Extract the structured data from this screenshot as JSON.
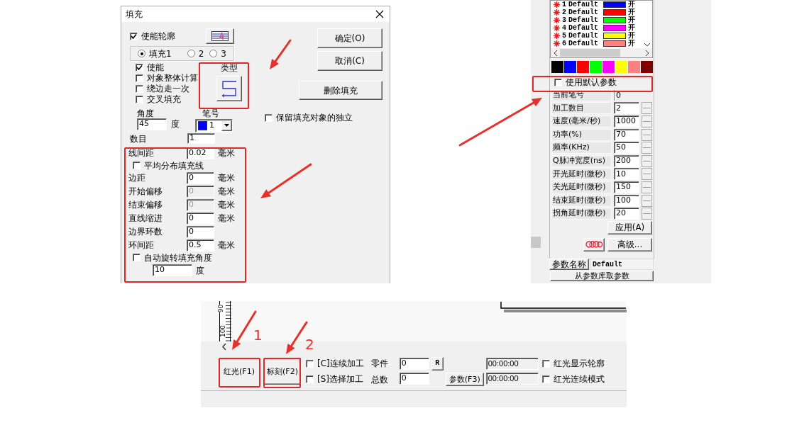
{
  "fill_dialog": {
    "title": "填充",
    "enable_contour": {
      "label": "使能轮廓",
      "checked": true
    },
    "fill_tabs": [
      {
        "label": "填充1",
        "selected": true
      },
      {
        "label": "2",
        "selected": false
      },
      {
        "label": "3",
        "selected": false
      }
    ],
    "options": [
      {
        "label": "使能",
        "checked": true
      },
      {
        "label": "对象整体计算",
        "checked": false
      },
      {
        "label": "绕边走一次",
        "checked": false
      },
      {
        "label": "交叉填充",
        "checked": false
      }
    ],
    "type_label": "类型",
    "angle": {
      "label": "角度",
      "value": "45",
      "unit": "度"
    },
    "pen": {
      "label": "笔号",
      "value": "1"
    },
    "count": {
      "label": "数目",
      "value": "1"
    },
    "settings": [
      {
        "kind": "field",
        "label": "线间距",
        "value": "0.02",
        "unit": "毫米",
        "disabled": false
      },
      {
        "kind": "checkbox",
        "label": "平均分布填充线",
        "checked": false
      },
      {
        "kind": "field",
        "label": "边距",
        "value": "0",
        "unit": "毫米",
        "disabled": false
      },
      {
        "kind": "field",
        "label": "开始偏移",
        "value": "0",
        "unit": "毫米",
        "disabled": true
      },
      {
        "kind": "field",
        "label": "结束偏移",
        "value": "0",
        "unit": "毫米",
        "disabled": true
      },
      {
        "kind": "field",
        "label": "直线缩进",
        "value": "0",
        "unit": "毫米",
        "disabled": false
      },
      {
        "kind": "field",
        "label": "边界环数",
        "value": "0",
        "disabled": false
      },
      {
        "kind": "field",
        "label": "环间距",
        "value": "0.5",
        "unit": "毫米",
        "disabled": false
      },
      {
        "kind": "checkbox",
        "label": "自动旋转填充角度",
        "checked": false
      },
      {
        "kind": "field",
        "value": "10",
        "unit": "度",
        "disabled": false
      }
    ],
    "buttons": [
      "确定(O)",
      "取消(C)",
      "删除填充"
    ],
    "keep_independent": {
      "label": "保留填充对象的独立",
      "checked": false
    }
  },
  "pen_panel": {
    "pens": [
      {
        "number": "1",
        "name": "Default",
        "color": "#0000ff",
        "state": "开"
      },
      {
        "number": "2",
        "name": "Default",
        "color": "#ff0000",
        "state": "开"
      },
      {
        "number": "3",
        "name": "Default",
        "color": "#00ff00",
        "state": "开"
      },
      {
        "number": "4",
        "name": "Default",
        "color": "#ff00ff",
        "state": "开"
      },
      {
        "number": "5",
        "name": "Default",
        "color": "#ffff00",
        "state": "开"
      },
      {
        "number": "6",
        "name": "Default",
        "color": "#ff8080",
        "state": "开"
      }
    ],
    "palette": [
      {
        "color": "#000000"
      },
      {
        "color": "#0000ff"
      },
      {
        "color": "#ff0000"
      },
      {
        "color": "#00ff00"
      },
      {
        "color": "#ff00ff"
      },
      {
        "color": "#ffff00"
      },
      {
        "color": "#ff8080"
      },
      {
        "color": "#800000"
      }
    ],
    "use_default": {
      "label": "使用默认参数",
      "checked": false
    },
    "params": [
      {
        "kind": "readonly",
        "label": "当前笔号",
        "value": "0"
      },
      {
        "kind": "spin",
        "label": "加工数目",
        "value": "2"
      },
      {
        "kind": "spin",
        "label": "速度(毫米/秒)",
        "value": "1000"
      },
      {
        "kind": "spin",
        "label": "功率(%)",
        "value": "70"
      },
      {
        "kind": "spin",
        "label": "频率(KHz)",
        "value": "50"
      },
      {
        "kind": "spin",
        "label": "Q脉冲宽度(ns)",
        "value": "200"
      },
      {
        "kind": "spin",
        "label": "开光延时(微秒)",
        "value": "10"
      },
      {
        "kind": "spin",
        "label": "关光延时(微秒)",
        "value": "150"
      },
      {
        "kind": "spin",
        "label": "结束延时(微秒)",
        "value": "100"
      },
      {
        "kind": "spin",
        "label": "拐角延时(微秒)",
        "value": "20"
      }
    ],
    "apply_button": "应用(A)",
    "advanced_button": "高级...",
    "param_name": {
      "label": "参数名称",
      "value": "Default"
    },
    "load_button": "从参数库取参数"
  },
  "main_window": {
    "ruler_labels": [
      "90",
      "100"
    ],
    "buttons": [
      "红光(F1)",
      "标刻(F2)"
    ],
    "modes": [
      {
        "label": "[C]连续加工",
        "checked": false
      },
      {
        "label": "[S]选择加工",
        "checked": false
      }
    ],
    "counters": [
      {
        "label": "零件",
        "value": "0"
      },
      {
        "label": "总数",
        "value": "0"
      }
    ],
    "reset_button": "R",
    "params_button": "参数(F3)",
    "times": [
      "00:00:00",
      "00:00:00"
    ],
    "red_light": [
      {
        "label": "红光显示轮廓",
        "checked": false
      },
      {
        "label": "红光连续模式",
        "checked": false
      }
    ]
  },
  "annotations": {
    "numbers": [
      "1",
      "2"
    ]
  }
}
